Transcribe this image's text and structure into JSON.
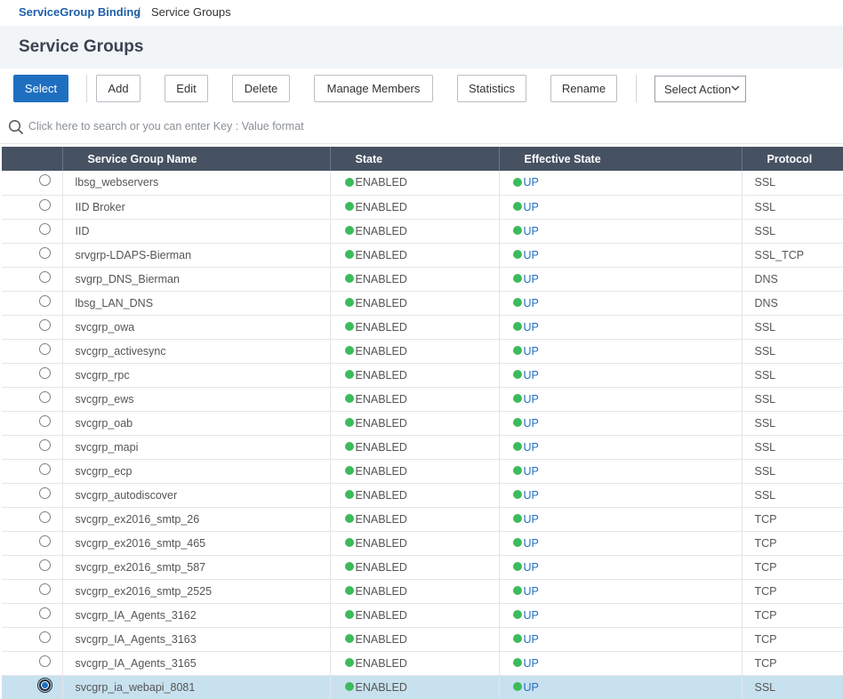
{
  "breadcrumb": {
    "link": "ServiceGroup Binding",
    "separator": "/",
    "current": "Service Groups"
  },
  "page_title": "Service Groups",
  "toolbar": {
    "select_label": "Select",
    "add_label": "Add",
    "edit_label": "Edit",
    "delete_label": "Delete",
    "manage_members_label": "Manage Members",
    "statistics_label": "Statistics",
    "rename_label": "Rename",
    "select_action_label": "Select Action"
  },
  "search": {
    "placeholder": "Click here to search or you can enter Key : Value format"
  },
  "table": {
    "columns": [
      "",
      "Service Group Name",
      "State",
      "Effective State",
      "Protocol"
    ],
    "rows": [
      {
        "name": "lbsg_webservers",
        "state": "ENABLED",
        "effective": "UP",
        "protocol": "SSL",
        "selected": false
      },
      {
        "name": "IID Broker",
        "state": "ENABLED",
        "effective": "UP",
        "protocol": "SSL",
        "selected": false
      },
      {
        "name": "IID",
        "state": "ENABLED",
        "effective": "UP",
        "protocol": "SSL",
        "selected": false
      },
      {
        "name": "srvgrp-LDAPS-Bierman",
        "state": "ENABLED",
        "effective": "UP",
        "protocol": "SSL_TCP",
        "selected": false
      },
      {
        "name": "svgrp_DNS_Bierman",
        "state": "ENABLED",
        "effective": "UP",
        "protocol": "DNS",
        "selected": false
      },
      {
        "name": "lbsg_LAN_DNS",
        "state": "ENABLED",
        "effective": "UP",
        "protocol": "DNS",
        "selected": false
      },
      {
        "name": "svcgrp_owa",
        "state": "ENABLED",
        "effective": "UP",
        "protocol": "SSL",
        "selected": false
      },
      {
        "name": "svcgrp_activesync",
        "state": "ENABLED",
        "effective": "UP",
        "protocol": "SSL",
        "selected": false
      },
      {
        "name": "svcgrp_rpc",
        "state": "ENABLED",
        "effective": "UP",
        "protocol": "SSL",
        "selected": false
      },
      {
        "name": "svcgrp_ews",
        "state": "ENABLED",
        "effective": "UP",
        "protocol": "SSL",
        "selected": false
      },
      {
        "name": "svcgrp_oab",
        "state": "ENABLED",
        "effective": "UP",
        "protocol": "SSL",
        "selected": false
      },
      {
        "name": "svcgrp_mapi",
        "state": "ENABLED",
        "effective": "UP",
        "protocol": "SSL",
        "selected": false
      },
      {
        "name": "svcgrp_ecp",
        "state": "ENABLED",
        "effective": "UP",
        "protocol": "SSL",
        "selected": false
      },
      {
        "name": "svcgrp_autodiscover",
        "state": "ENABLED",
        "effective": "UP",
        "protocol": "SSL",
        "selected": false
      },
      {
        "name": "svcgrp_ex2016_smtp_26",
        "state": "ENABLED",
        "effective": "UP",
        "protocol": "TCP",
        "selected": false
      },
      {
        "name": "svcgrp_ex2016_smtp_465",
        "state": "ENABLED",
        "effective": "UP",
        "protocol": "TCP",
        "selected": false
      },
      {
        "name": "svcgrp_ex2016_smtp_587",
        "state": "ENABLED",
        "effective": "UP",
        "protocol": "TCP",
        "selected": false
      },
      {
        "name": "svcgrp_ex2016_smtp_2525",
        "state": "ENABLED",
        "effective": "UP",
        "protocol": "TCP",
        "selected": false
      },
      {
        "name": "svcgrp_IA_Agents_3162",
        "state": "ENABLED",
        "effective": "UP",
        "protocol": "TCP",
        "selected": false
      },
      {
        "name": "svcgrp_IA_Agents_3163",
        "state": "ENABLED",
        "effective": "UP",
        "protocol": "TCP",
        "selected": false
      },
      {
        "name": "svcgrp_IA_Agents_3165",
        "state": "ENABLED",
        "effective": "UP",
        "protocol": "TCP",
        "selected": false
      },
      {
        "name": "svcgrp_ia_webapi_8081",
        "state": "ENABLED",
        "effective": "UP",
        "protocol": "SSL",
        "selected": true
      }
    ]
  },
  "colors": {
    "accent": "#1f6fc0",
    "header_bg": "#465162",
    "status_green": "#3dbb5a",
    "selected_row": "#c8e1ef"
  },
  "icons": {
    "search": "search-icon",
    "select_chevron": "chevron-down-icon",
    "status": "status-dot-icon"
  }
}
